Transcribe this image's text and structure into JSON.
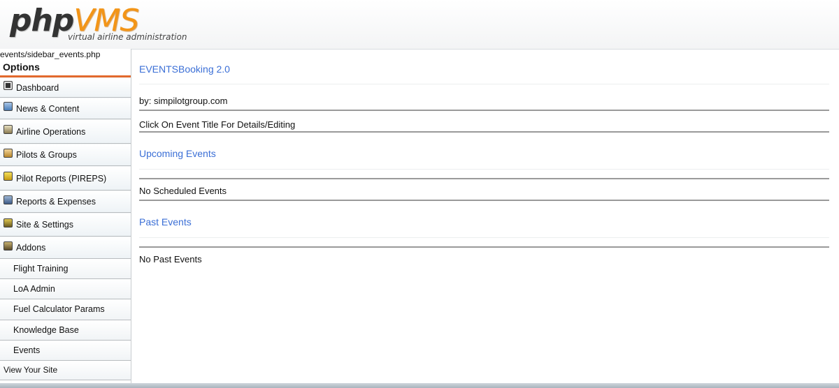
{
  "logo": {
    "php": "php",
    "vms": "VMS",
    "tagline": "virtual airline administration"
  },
  "sidebar": {
    "path": "events/sidebar_events.php",
    "options_title": "Options",
    "items": [
      {
        "label": "Dashboard",
        "icon": "dashboard-icon"
      },
      {
        "label": "News & Content",
        "icon": "news-icon"
      },
      {
        "label": "Airline Operations",
        "icon": "airline-icon"
      },
      {
        "label": "Pilots & Groups",
        "icon": "pilots-icon"
      },
      {
        "label": "Pilot Reports (PIREPS)",
        "icon": "pireps-icon"
      },
      {
        "label": "Reports & Expenses",
        "icon": "reports-icon"
      },
      {
        "label": "Site & Settings",
        "icon": "settings-icon"
      },
      {
        "label": "Addons",
        "icon": "addons-icon"
      }
    ],
    "addons": [
      "Flight Training",
      "LoA Admin",
      "Fuel Calculator Params",
      "Knowledge Base",
      "Events"
    ],
    "view_site": "View Your Site"
  },
  "main": {
    "title": "EVENTSBooking 2.0",
    "by": "by: simpilotgroup.com",
    "instruction": "Click On Event Title For Details/Editing",
    "upcoming_heading": "Upcoming Events",
    "upcoming_empty": "No Scheduled Events",
    "past_heading": "Past Events",
    "past_empty": "No Past Events"
  },
  "colors": {
    "accent_orange": "#f39517",
    "link_blue": "#3b6fd6",
    "options_underline": "#e2692d"
  }
}
